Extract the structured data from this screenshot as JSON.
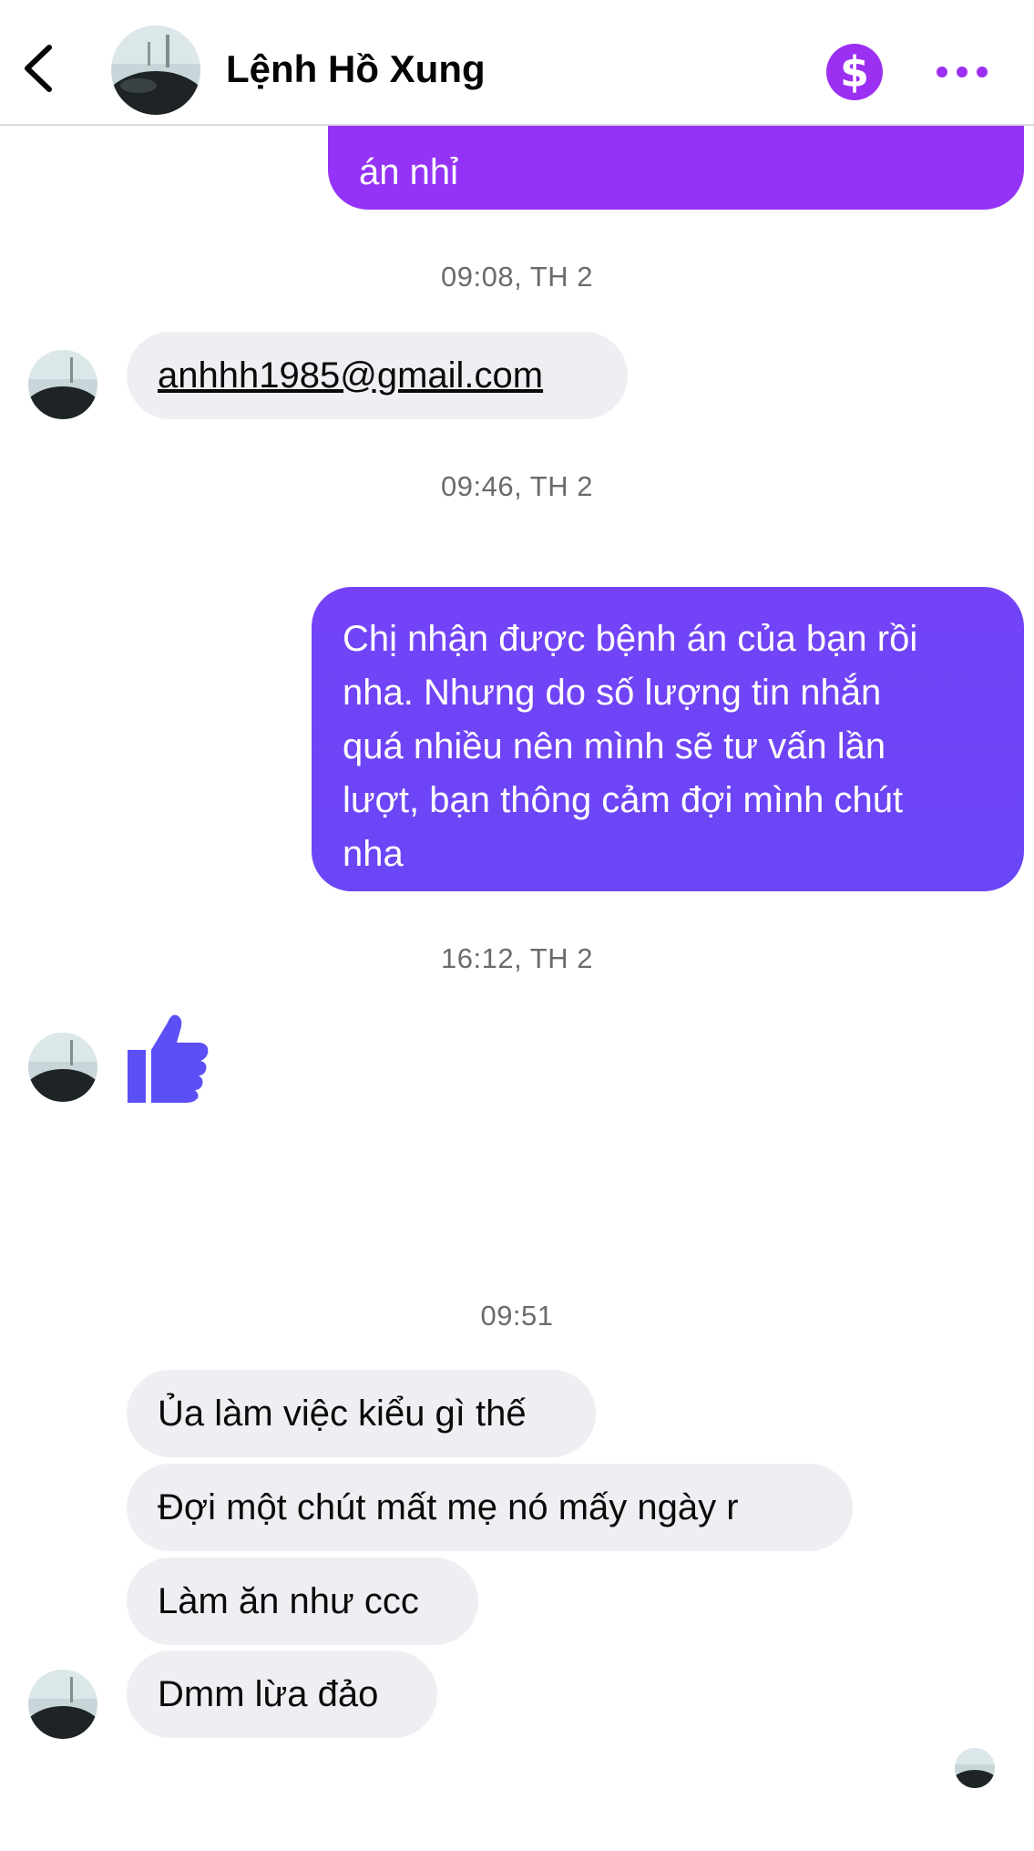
{
  "header": {
    "contact_name": "Lệnh Hồ Xung",
    "payment_icon": "dollar-icon",
    "more_icon": "more-icon",
    "back_icon": "chevron-left-icon",
    "accent_color": "#9b2ff2"
  },
  "messages": {
    "top_outgoing": "án nhỉ",
    "ts1": "09:08, TH 2",
    "email": "anhhh1985@gmail.com",
    "ts2": "09:46, TH 2",
    "long_outgoing": "Chị nhận được bệnh án của bạn rồi\nnha. Nhưng do số lượng tin nhắn\nquá nhiều nên mình sẽ tư vấn lần\nlượt, bạn thông cảm đợi mình chút\nnha",
    "ts3": "16:12, TH 2",
    "like_icon": "thumbs-up-icon",
    "ts4": "09:51",
    "incoming": [
      "Ủa làm việc kiểu gì thế",
      "Đợi một chút mất mẹ nó mấy ngày r",
      "Làm ăn như ccc",
      "Dmm lừa đảo"
    ]
  },
  "colors": {
    "outgoing_top": "#9433f5",
    "outgoing_long": "#6e45f6",
    "incoming_bg": "#efeff3",
    "like": "#5b4ff5"
  }
}
